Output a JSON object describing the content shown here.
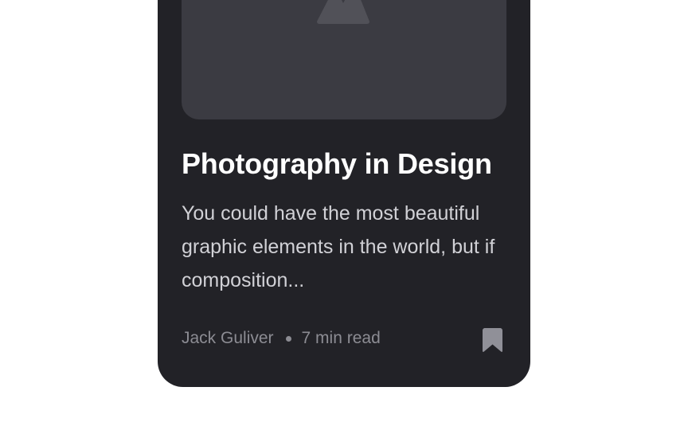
{
  "article": {
    "title": "Photography in Design",
    "excerpt": "You could have the most beautiful graphic elements in the world, but if composition...",
    "author": "Jack Guliver",
    "read_time": "7 min read"
  },
  "icons": {
    "image_placeholder": "image-placeholder-icon",
    "bookmark": "bookmark-icon"
  },
  "colors": {
    "page_background": "#ffffff",
    "card_background": "#222227",
    "image_background": "#3b3b42",
    "title_text": "#ffffff",
    "body_text": "#d1d1d6",
    "meta_text": "#8c8c93"
  }
}
